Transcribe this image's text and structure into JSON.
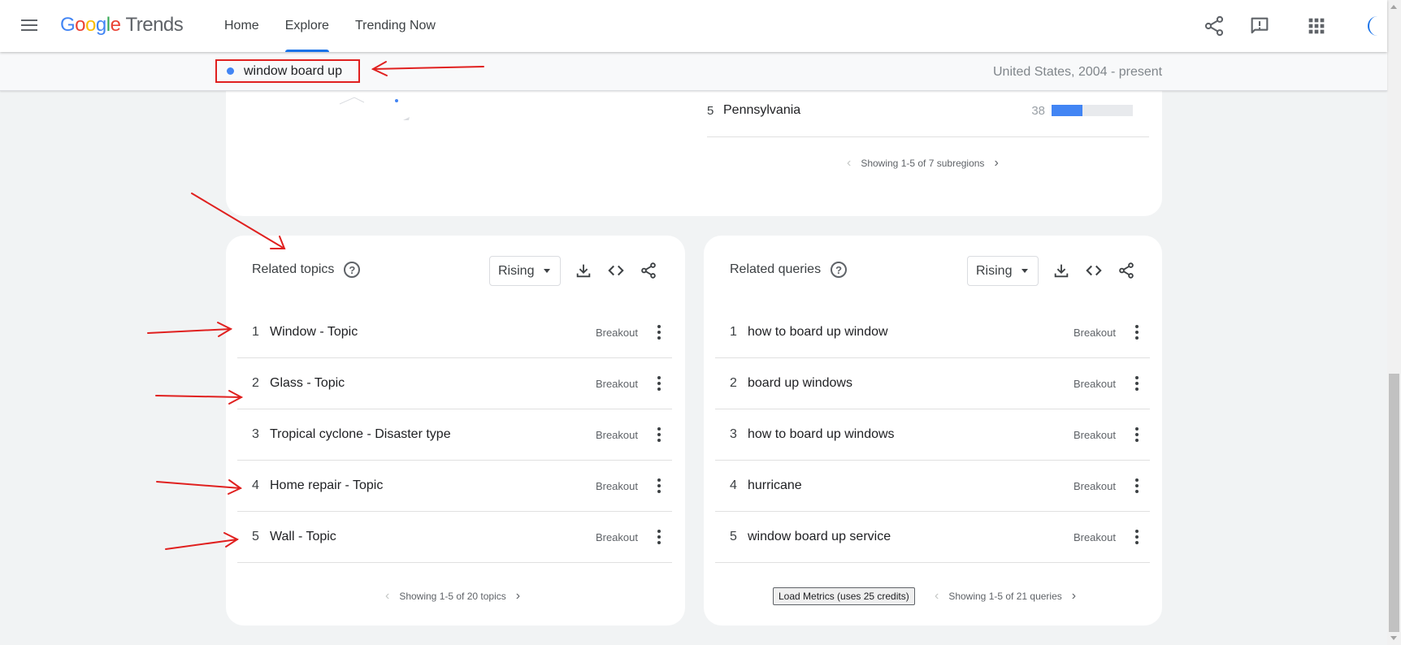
{
  "header": {
    "logo_google": [
      "G",
      "o",
      "o",
      "g",
      "l",
      "e"
    ],
    "logo_trends": "Trends",
    "nav": [
      "Home",
      "Explore",
      "Trending Now"
    ],
    "active_nav": "Explore"
  },
  "term_bar": {
    "term": "window board up",
    "term_color": "#4285f4",
    "region": "United States, 2004 - present"
  },
  "subregion": {
    "row": {
      "rank": "5",
      "name": "Pennsylvania",
      "value": "38",
      "bar_fraction": 0.38
    },
    "pager": "Showing 1-5 of 7 subregions"
  },
  "related_topics": {
    "title": "Related topics",
    "help": "?",
    "filter": "Rising",
    "rows": [
      {
        "rank": "1",
        "label": "Window - Topic",
        "value": "Breakout"
      },
      {
        "rank": "2",
        "label": "Glass - Topic",
        "value": "Breakout"
      },
      {
        "rank": "3",
        "label": "Tropical cyclone - Disaster type",
        "value": "Breakout"
      },
      {
        "rank": "4",
        "label": "Home repair - Topic",
        "value": "Breakout"
      },
      {
        "rank": "5",
        "label": "Wall - Topic",
        "value": "Breakout"
      }
    ],
    "pager": "Showing 1-5 of 20 topics"
  },
  "related_queries": {
    "title": "Related queries",
    "help": "?",
    "filter": "Rising",
    "rows": [
      {
        "rank": "1",
        "label": "how to board up window",
        "value": "Breakout"
      },
      {
        "rank": "2",
        "label": "board up windows",
        "value": "Breakout"
      },
      {
        "rank": "3",
        "label": "how to board up windows",
        "value": "Breakout"
      },
      {
        "rank": "4",
        "label": "hurricane",
        "value": "Breakout"
      },
      {
        "rank": "5",
        "label": "window board up service",
        "value": "Breakout"
      }
    ],
    "load_button": "Load Metrics (uses 25 credits)",
    "pager": "Showing 1-5 of 21 queries"
  },
  "colors": {
    "accent": "#1a73e8",
    "bar": "#4285f4",
    "annotation": "#e0201f"
  }
}
